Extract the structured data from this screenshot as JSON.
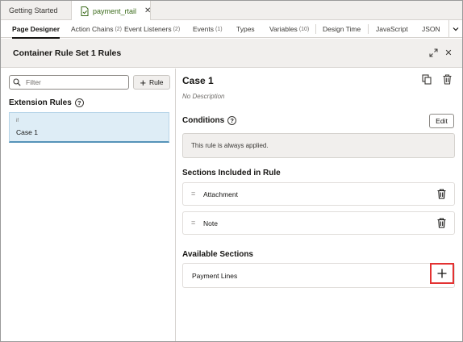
{
  "file_tabs": [
    {
      "label": "Getting Started"
    },
    {
      "label": "payment_rtail",
      "icon": "file-check-icon",
      "closable": true
    }
  ],
  "designer_tabs": [
    {
      "label": "Page Designer",
      "count": "",
      "active": true
    },
    {
      "label": "Action Chains",
      "count": "(2)"
    },
    {
      "label": "Event Listeners",
      "count": "(2)"
    },
    {
      "label": "Events",
      "count": "(1)"
    },
    {
      "label": "Types",
      "count": ""
    },
    {
      "label": "Variables",
      "count": "(10)"
    },
    {
      "label": "Design Time",
      "count": ""
    },
    {
      "label": "JavaScript",
      "count": ""
    },
    {
      "label": "JSON",
      "count": ""
    }
  ],
  "panel": {
    "title": "Container Rule Set 1 Rules"
  },
  "left": {
    "filter_placeholder": "Filter",
    "rule_button_label": "Rule",
    "extension_rules_title": "Extension Rules",
    "rules": [
      {
        "condition": "if",
        "name": "Case 1",
        "selected": true
      }
    ]
  },
  "right": {
    "case_title": "Case 1",
    "case_description": "No Description",
    "conditions_title": "Conditions",
    "edit_label": "Edit",
    "applied_text": "This rule is always applied.",
    "sections_included_title": "Sections Included in Rule",
    "sections_included": [
      {
        "grip": "=",
        "label": "Attachment"
      },
      {
        "grip": "=",
        "label": "Note"
      }
    ],
    "available_title": "Available Sections",
    "available_sections": [
      {
        "label": "Payment Lines"
      }
    ]
  },
  "colors": {
    "accent_selected_bg": "#deedf6",
    "accent_selected_border": "#5693b8",
    "highlight_red": "#e33232",
    "file_tab_text": "#3a6a1a"
  }
}
